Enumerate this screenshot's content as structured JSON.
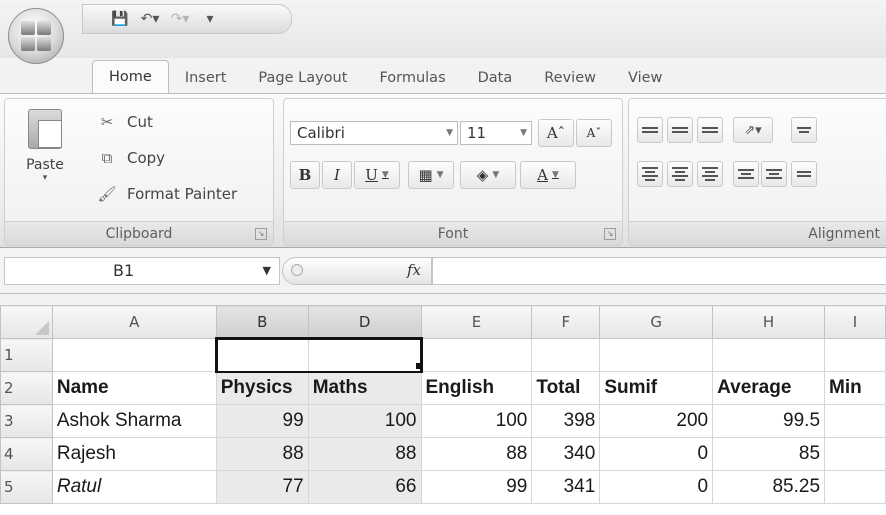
{
  "tabs": [
    "Home",
    "Insert",
    "Page Layout",
    "Formulas",
    "Data",
    "Review",
    "View"
  ],
  "active_tab": "Home",
  "clipboard": {
    "paste_label": "Paste",
    "cut_label": "Cut",
    "copy_label": "Copy",
    "format_painter_label": "Format Painter",
    "group_label": "Clipboard"
  },
  "font_group": {
    "font_name": "Calibri",
    "font_size": "11",
    "group_label": "Font"
  },
  "alignment_group": {
    "group_label": "Alignment"
  },
  "formula_bar": {
    "name_box": "B1",
    "fx_label": "fx",
    "formula": ""
  },
  "sheet": {
    "columns": [
      "A",
      "B",
      "D",
      "E",
      "F",
      "G",
      "H",
      "I"
    ],
    "selected_columns": [
      "B",
      "D"
    ],
    "rows": [
      {
        "num": "1",
        "cells": [
          "",
          "",
          "",
          "",
          "",
          "",
          "",
          ""
        ]
      },
      {
        "num": "2",
        "cells": [
          "Name",
          "Physics",
          "Maths",
          "English",
          "Total",
          "Sumif",
          "Average",
          "Min"
        ]
      },
      {
        "num": "3",
        "cells": [
          "Ashok Sharma",
          "99",
          "100",
          "100",
          "398",
          "200",
          "99.5",
          ""
        ]
      },
      {
        "num": "4",
        "cells": [
          "Rajesh",
          "88",
          "88",
          "88",
          "340",
          "0",
          "85",
          ""
        ]
      },
      {
        "num": "5",
        "cells": [
          "Ratul",
          "77",
          "66",
          "99",
          "341",
          "0",
          "85.25",
          ""
        ]
      }
    ]
  },
  "colors": {
    "selection_fill": "#eaeaea",
    "selection_border": "#111111",
    "ribbon_bg": "#f0f0f0"
  }
}
